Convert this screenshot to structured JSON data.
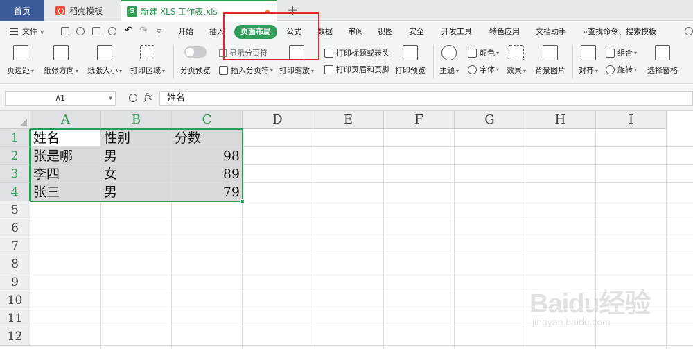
{
  "tabs": {
    "home": "首页",
    "template": "稻壳模板",
    "document": "新建 XLS 工作表.xls",
    "plus": "+"
  },
  "menu": {
    "file": "文件",
    "items": [
      "开始",
      "插入",
      "页面布局",
      "公式",
      "数据",
      "审阅",
      "视图",
      "安全",
      "开发工具",
      "特色应用",
      "文档助手"
    ],
    "search": "查找命令、搜索模板",
    "active_index": 2
  },
  "ribbon": {
    "margins": "页边距",
    "orientation": "纸张方向",
    "size": "纸张大小",
    "print_area": "打印区域",
    "page_break_preview": "分页预览",
    "show_page_breaks": "显示分页符",
    "insert_page_break": "插入分页符",
    "print_scale": "打印缩放",
    "print_titles": "打印标题或表头",
    "header_footer": "打印页眉和页脚",
    "print_preview": "打印预览",
    "theme": "主题",
    "colors": "颜色",
    "fonts": "字体",
    "effects": "效果",
    "background": "背景图片",
    "align": "对齐",
    "group": "组合",
    "rotate": "旋转",
    "selection_pane": "选择窗格"
  },
  "formula_bar": {
    "name_box": "A1",
    "fx": "fx",
    "content": "姓名"
  },
  "columns": [
    "A",
    "B",
    "C",
    "D",
    "E",
    "F",
    "G",
    "H",
    "I"
  ],
  "rows": [
    "1",
    "2",
    "3",
    "4",
    "5",
    "6",
    "7",
    "8",
    "9",
    "10",
    "11",
    "12"
  ],
  "sheet": [
    [
      "姓名",
      "性别",
      "分数"
    ],
    [
      "张是哪",
      "男",
      "98"
    ],
    [
      "李四",
      "女",
      "89"
    ],
    [
      "张三",
      "男",
      "79"
    ]
  ],
  "watermark": {
    "brand": "Baidu经验",
    "url": "jingyan.baidu.com"
  },
  "colors": {
    "accent": "#2f9c59",
    "highlight": "#e0262c",
    "home_tab": "#3d5b9a"
  }
}
